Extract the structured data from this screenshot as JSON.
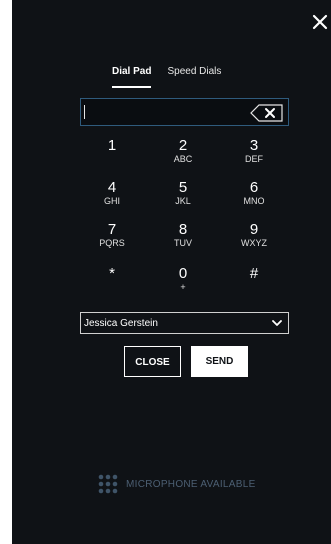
{
  "tabs": [
    {
      "label": "Dial Pad",
      "active": true
    },
    {
      "label": "Speed Dials",
      "active": false
    }
  ],
  "dial_input": {
    "value": ""
  },
  "keypad": [
    {
      "digit": "1",
      "letters": ""
    },
    {
      "digit": "2",
      "letters": "ABC"
    },
    {
      "digit": "3",
      "letters": "DEF"
    },
    {
      "digit": "4",
      "letters": "GHI"
    },
    {
      "digit": "5",
      "letters": "JKL"
    },
    {
      "digit": "6",
      "letters": "MNO"
    },
    {
      "digit": "7",
      "letters": "PQRS"
    },
    {
      "digit": "8",
      "letters": "TUV"
    },
    {
      "digit": "9",
      "letters": "WXYZ"
    },
    {
      "digit": "*",
      "letters": ""
    },
    {
      "digit": "0",
      "letters": "+"
    },
    {
      "digit": "#",
      "letters": ""
    }
  ],
  "caller_select": {
    "selected": "Jessica Gerstein"
  },
  "buttons": {
    "close": "CLOSE",
    "send": "SEND"
  },
  "microphone": {
    "label": "MICROPHONE AVAILABLE"
  },
  "icons": {
    "close": "close-icon",
    "backspace": "backspace-icon",
    "chevron": "chevron-down-icon",
    "microphone": "dots-grid-icon"
  },
  "colors": {
    "panel_bg": "#0f1216",
    "input_border": "#2f5b7d",
    "mic_text": "#4c5f73",
    "text": "#ffffff"
  }
}
